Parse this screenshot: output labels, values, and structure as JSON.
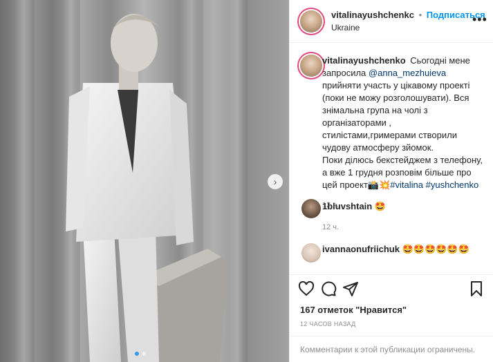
{
  "header": {
    "username": "vitalinayushchenkc",
    "separator": "•",
    "follow_label": "Подписаться",
    "location": "Ukraine",
    "more_icon": "more-horizontal-icon"
  },
  "caption": {
    "username": "vitalinayushchenko",
    "text_1": "Сьогодні мене запросила",
    "mention": "@anna_mezhuieva",
    "text_2": "прийняти участь у цікавому проекті (поки не можу розголошувати). Вся знімальна група на чолі з організаторами , стилістами,гримерами створили чудову атмосферу зйомок.",
    "text_3": "Поки ділюсь бекстейджем з телефону, а вже 1 грудня розповім більше про цей проект📸💥",
    "hashtag_1": "#vitalina",
    "hashtag_2": "#yushchenko",
    "time": "12 ч."
  },
  "comments": [
    {
      "username": "1bluvshtain",
      "text": "🤩",
      "time": "12 ч."
    },
    {
      "username": "ivannaonufriichuk",
      "text": "🤩🤩🤩🤩🤩🤩"
    }
  ],
  "actions": {
    "like_icon": "heart-icon",
    "comment_icon": "comment-icon",
    "share_icon": "send-icon",
    "save_icon": "bookmark-icon"
  },
  "likes_text": "167 отметок \"Нравится\"",
  "posted_ago": "12 ЧАСОВ НАЗАД",
  "comments_limited": "Комментарии к этой публикации ограничены.",
  "carousel": {
    "next_icon": "chevron-right-icon",
    "slide_count": 2,
    "active_slide": 1
  },
  "colors": {
    "follow": "#0095f6",
    "link": "#00376b",
    "muted": "#8e8e8e",
    "border": "#efefef",
    "active_dot": "#3897f0"
  }
}
